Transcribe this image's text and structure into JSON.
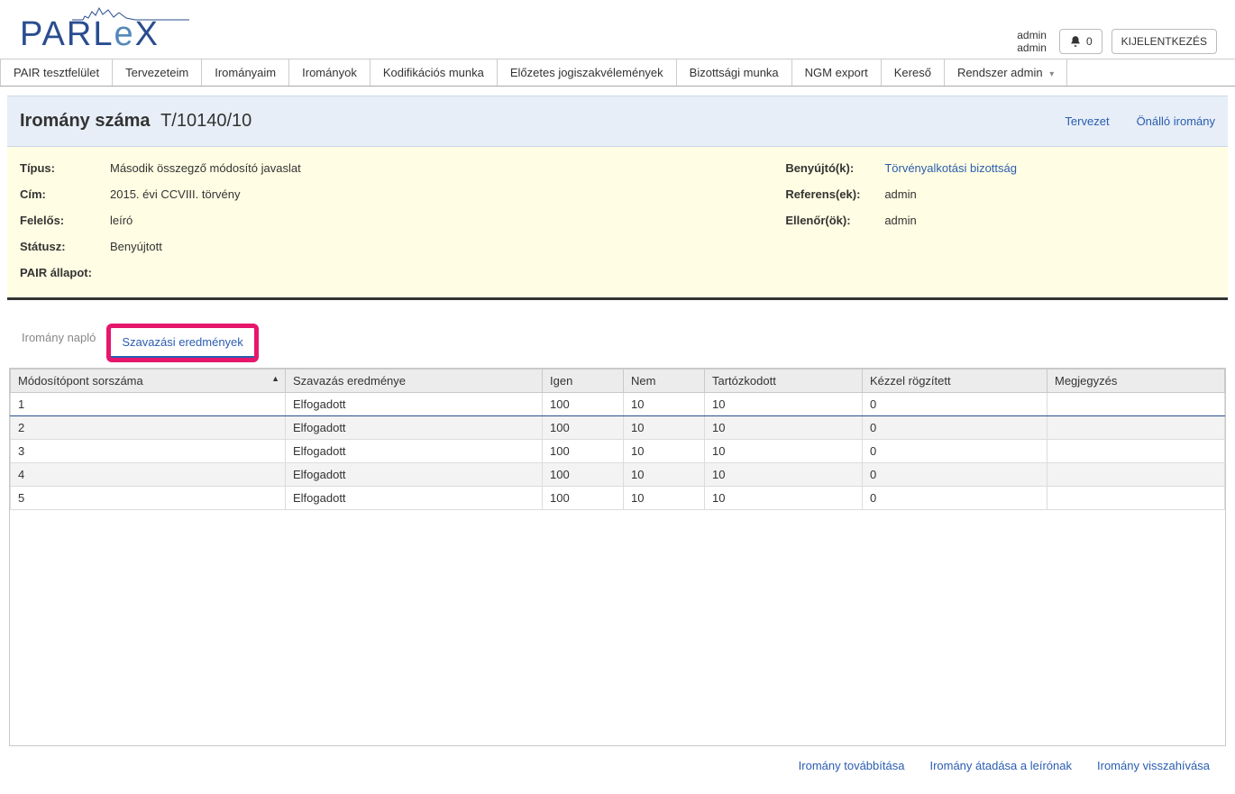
{
  "user": {
    "name": "admin",
    "role": "admin"
  },
  "topbar": {
    "notifications_count": "0",
    "logout_label": "KIJELENTKEZÉS"
  },
  "mainmenu": [
    "PAIR tesztfelület",
    "Tervezeteim",
    "Irományaim",
    "Irományok",
    "Kodifikációs munka",
    "Előzetes jogiszakvélemények",
    "Bizottsági munka",
    "NGM export",
    "Kereső",
    "Rendszer admin"
  ],
  "header": {
    "title": "Iromány száma",
    "number": "T/10140/10",
    "links": {
      "tervezet": "Tervezet",
      "onallo": "Önálló iromány"
    }
  },
  "info": {
    "left": {
      "tipus_k": "Típus:",
      "tipus_v": "Második összegző módosító javaslat",
      "cim_k": "Cím:",
      "cim_v": "2015. évi CCVIII. törvény",
      "felelos_k": "Felelős:",
      "felelos_v": "leíró",
      "statusz_k": "Státusz:",
      "statusz_v": "Benyújtott",
      "pair_k": "PAIR állapot:",
      "pair_v": ""
    },
    "right": {
      "benyujto_k": "Benyújtó(k):",
      "benyujto_v": "Törvényalkotási bizottság",
      "referens_k": "Referens(ek):",
      "referens_v": "admin",
      "ellenor_k": "Ellenőr(ök):",
      "ellenor_v": "admin"
    }
  },
  "subtabs": {
    "naplo": "Iromány napló",
    "szavazasi": "Szavazási eredmények"
  },
  "table": {
    "headers": {
      "sorszam": "Módosítópont sorszáma",
      "eredmeny": "Szavazás eredménye",
      "igen": "Igen",
      "nem": "Nem",
      "tart": "Tartózkodott",
      "kezzel": "Kézzel rögzített",
      "megj": "Megjegyzés"
    },
    "rows": [
      {
        "sorszam": "1",
        "eredmeny": "Elfogadott",
        "igen": "100",
        "nem": "10",
        "tart": "10",
        "kezzel": "0",
        "megj": ""
      },
      {
        "sorszam": "2",
        "eredmeny": "Elfogadott",
        "igen": "100",
        "nem": "10",
        "tart": "10",
        "kezzel": "0",
        "megj": ""
      },
      {
        "sorszam": "3",
        "eredmeny": "Elfogadott",
        "igen": "100",
        "nem": "10",
        "tart": "10",
        "kezzel": "0",
        "megj": ""
      },
      {
        "sorszam": "4",
        "eredmeny": "Elfogadott",
        "igen": "100",
        "nem": "10",
        "tart": "10",
        "kezzel": "0",
        "megj": ""
      },
      {
        "sorszam": "5",
        "eredmeny": "Elfogadott",
        "igen": "100",
        "nem": "10",
        "tart": "10",
        "kezzel": "0",
        "megj": ""
      }
    ]
  },
  "footer": {
    "tovabbitasa": "Iromány továbbítása",
    "atadasa": "Iromány átadása a leírónak",
    "visszahivasa": "Iromány visszahívása"
  }
}
